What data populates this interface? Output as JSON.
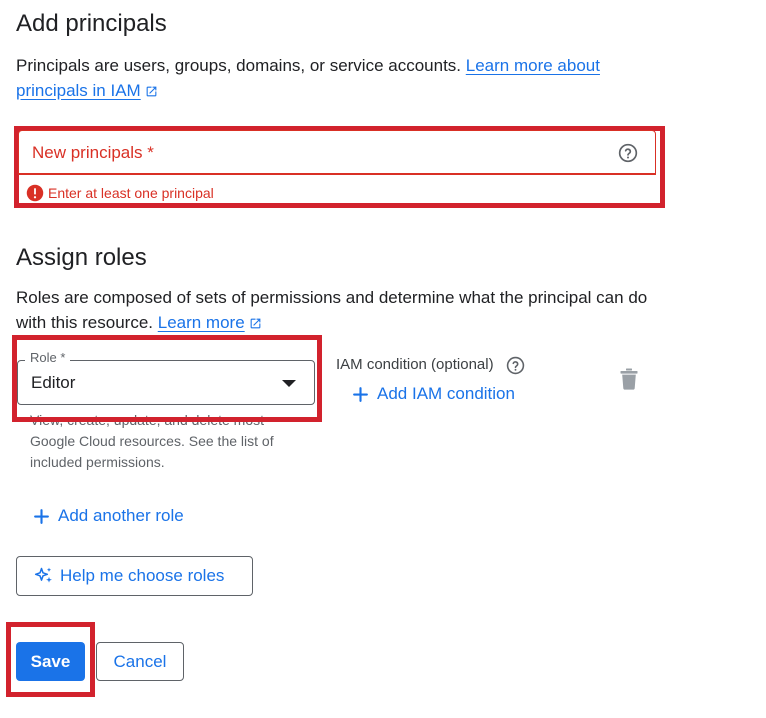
{
  "principals_section": {
    "title": "Add principals",
    "description": "Principals are users, groups, domains, or service accounts.",
    "learn_more": "Learn more about principals in IAM",
    "field_label": "New principals *",
    "error": "Enter at least one principal"
  },
  "roles_section": {
    "title": "Assign roles",
    "description": "Roles are composed of sets of permissions and determine what the principal can do with this resource.",
    "learn_more": "Learn more",
    "role_label": "Role *",
    "role_value": "Editor",
    "role_help": "View, create, update, and delete most Google Cloud resources. See the list of included permissions.",
    "condition_label": "IAM condition (optional)",
    "add_condition": "Add IAM condition",
    "add_another_role": "Add another role",
    "help_choose": "Help me choose roles"
  },
  "actions": {
    "save": "Save",
    "cancel": "Cancel"
  },
  "colors": {
    "accent": "#1a73e8",
    "error": "#d93025",
    "highlight": "#d2222d"
  }
}
